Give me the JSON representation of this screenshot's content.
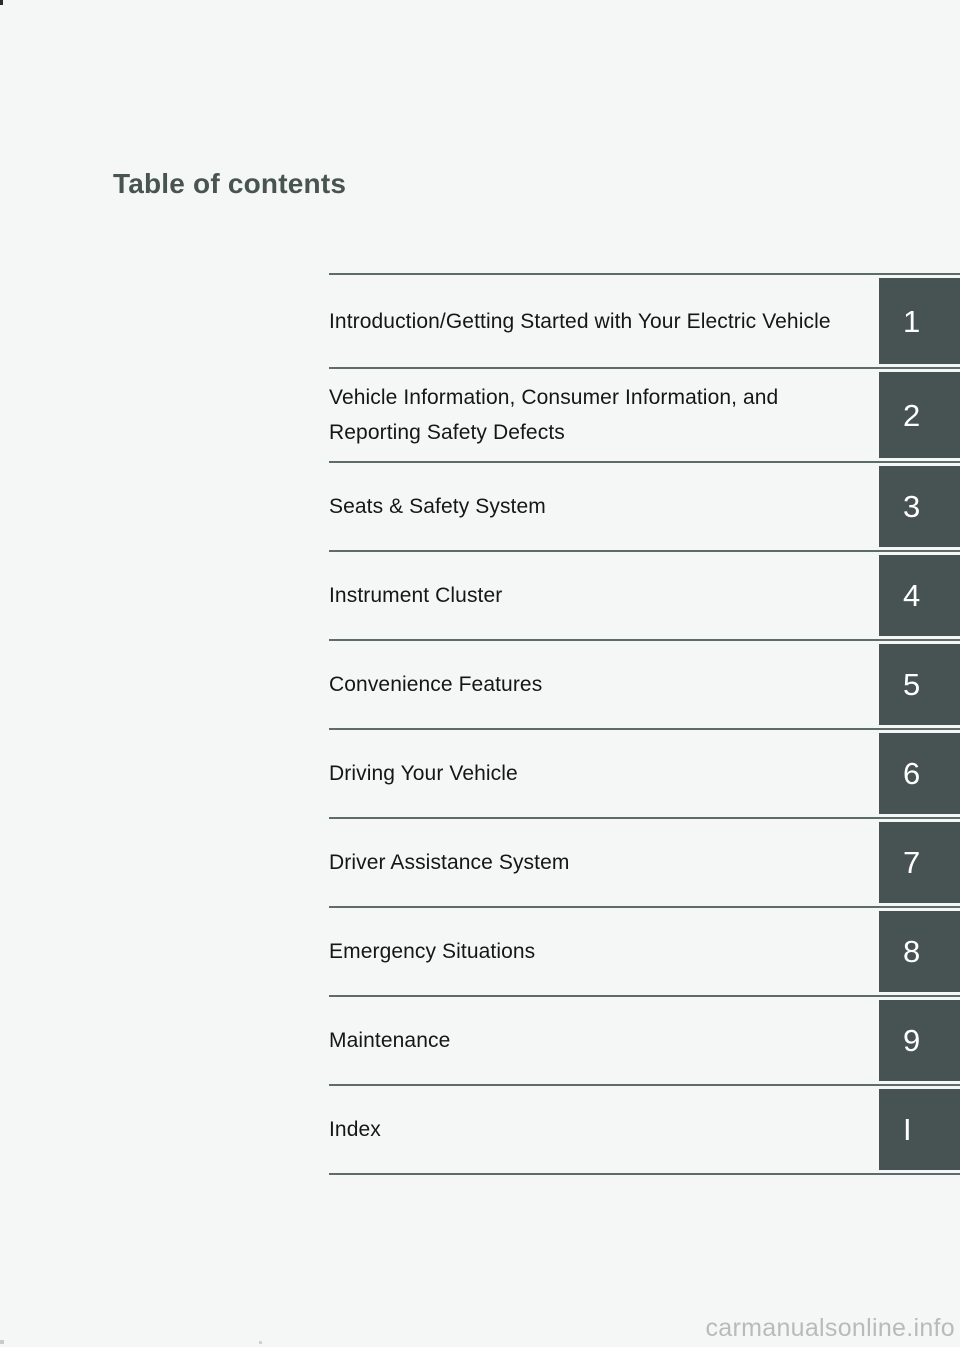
{
  "page": {
    "title": "Table of contents",
    "background_color": "#f5f6f6",
    "title_color": "#48544f",
    "tab_color": "#475352",
    "rule_color": "#5d6b69",
    "label_color": "#161616",
    "watermark_color": "#b9bbbb"
  },
  "watermark": {
    "text": "carmanualsonline.info"
  },
  "toc": {
    "rows": [
      {
        "label": "Introduction/Getting Started with Your Electric Vehicle",
        "tab": "1"
      },
      {
        "label": "Vehicle Information, Consumer Information, and Reporting Safety Defects",
        "tab": "2"
      },
      {
        "label": "Seats & Safety System",
        "tab": "3"
      },
      {
        "label": "Instrument Cluster",
        "tab": "4"
      },
      {
        "label": "Convenience Features",
        "tab": "5"
      },
      {
        "label": "Driving Your Vehicle",
        "tab": "6"
      },
      {
        "label": "Driver Assistance System",
        "tab": "7"
      },
      {
        "label": "Emergency Situations",
        "tab": "8"
      },
      {
        "label": "Maintenance",
        "tab": "9"
      },
      {
        "label": "Index",
        "tab": "I"
      }
    ]
  }
}
